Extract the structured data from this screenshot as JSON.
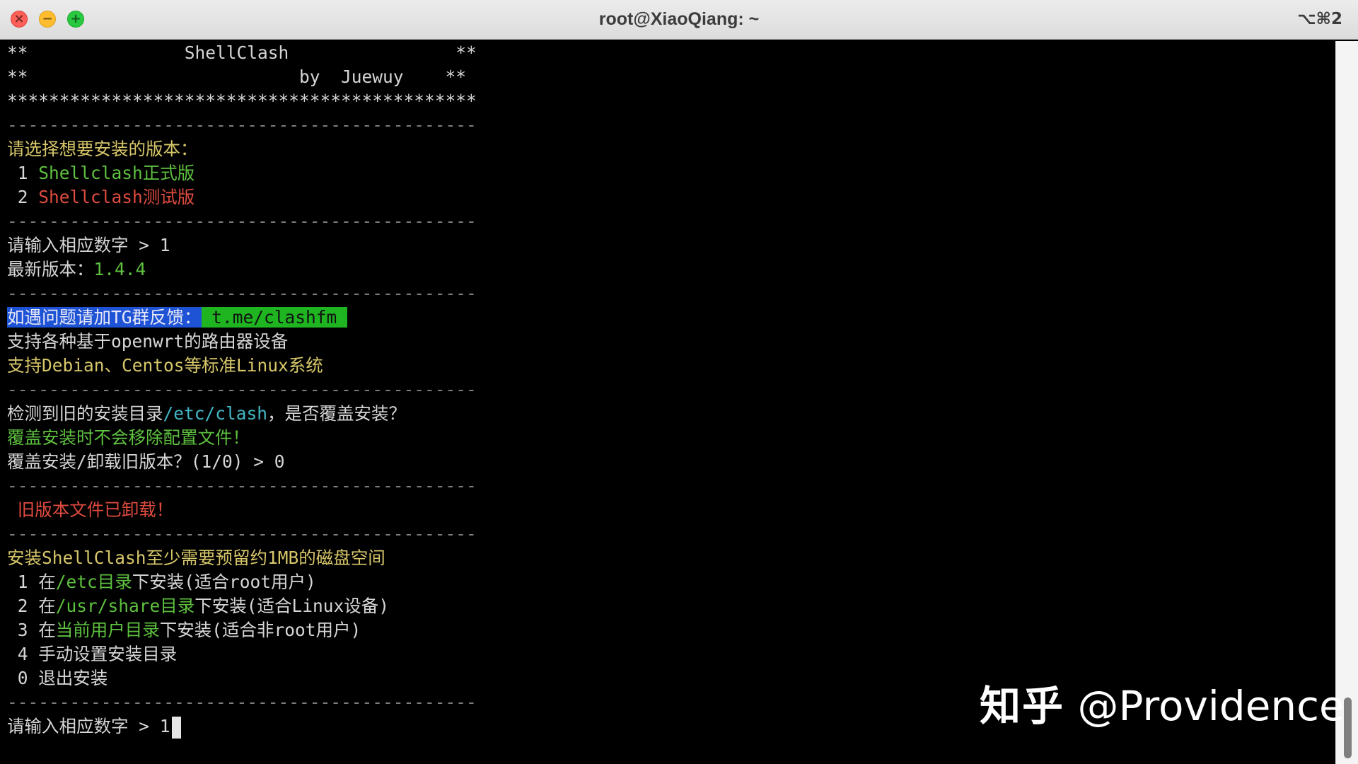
{
  "window": {
    "title": "root@XiaoQiang: ~",
    "shortcut": "⌥⌘2",
    "close_glyph": "×",
    "minimize_glyph": "−",
    "zoom_glyph": "+"
  },
  "terminal": {
    "line_header_name": "**               ShellClash                **",
    "line_header_author": "**                          by  Juewuy    **",
    "line_stars": "*********************************************",
    "separator": "---------------------------------------------",
    "choose_version": "请选择想要安装的版本：",
    "version_1_num": " 1 ",
    "version_1_label": "Shellclash正式版",
    "version_2_num": " 2 ",
    "version_2_label": "Shellclash测试版",
    "input_prompt_1": "请输入相应数字 > 1",
    "latest_version_label": "最新版本：",
    "latest_version_value": "1.4.4",
    "tg_feedback_label": "如遇问题请加TG群反馈：",
    "tg_link": " t.me/clashfm ",
    "support_openwrt": "支持各种基于openwrt的路由器设备",
    "support_linux": "支持Debian、Centos等标准Linux系统",
    "old_dir_prefix": "检测到旧的安装目录",
    "old_dir_path": "/etc/clash",
    "old_dir_suffix": "，是否覆盖安装？",
    "overwrite_note": "覆盖安装时不会移除配置文件！",
    "uninstall_prompt": "覆盖安装/卸载旧版本？(1/0) > 0",
    "uninstalled_msg": " 旧版本文件已卸载！",
    "disk_space_msg": "安装ShellClash至少需要预留约1MB的磁盘空间",
    "opt1_num": " 1 在",
    "opt1_path": "/etc目录",
    "opt1_suffix": "下安装(适合root用户)",
    "opt2_num": " 2 在",
    "opt2_path": "/usr/share目录",
    "opt2_suffix": "下安装(适合Linux设备)",
    "opt3_num": " 3 在",
    "opt3_path": "当前用户目录",
    "opt3_suffix": "下安装(适合非root用户)",
    "opt4": " 4 手动设置安装目录",
    "opt0": " 0 退出安装",
    "input_prompt_2": "请输入相应数字 > 1"
  },
  "watermark": {
    "site": "知乎",
    "author": " @Providence"
  },
  "colors": {
    "tg_label_bg": "#1e53d6",
    "tg_link_bg": "#1fb521",
    "yellow_text": "#d7c76a",
    "green_text": "#5ec13f",
    "red_text": "#df4b3f",
    "cyan_text": "#41b7c4"
  }
}
